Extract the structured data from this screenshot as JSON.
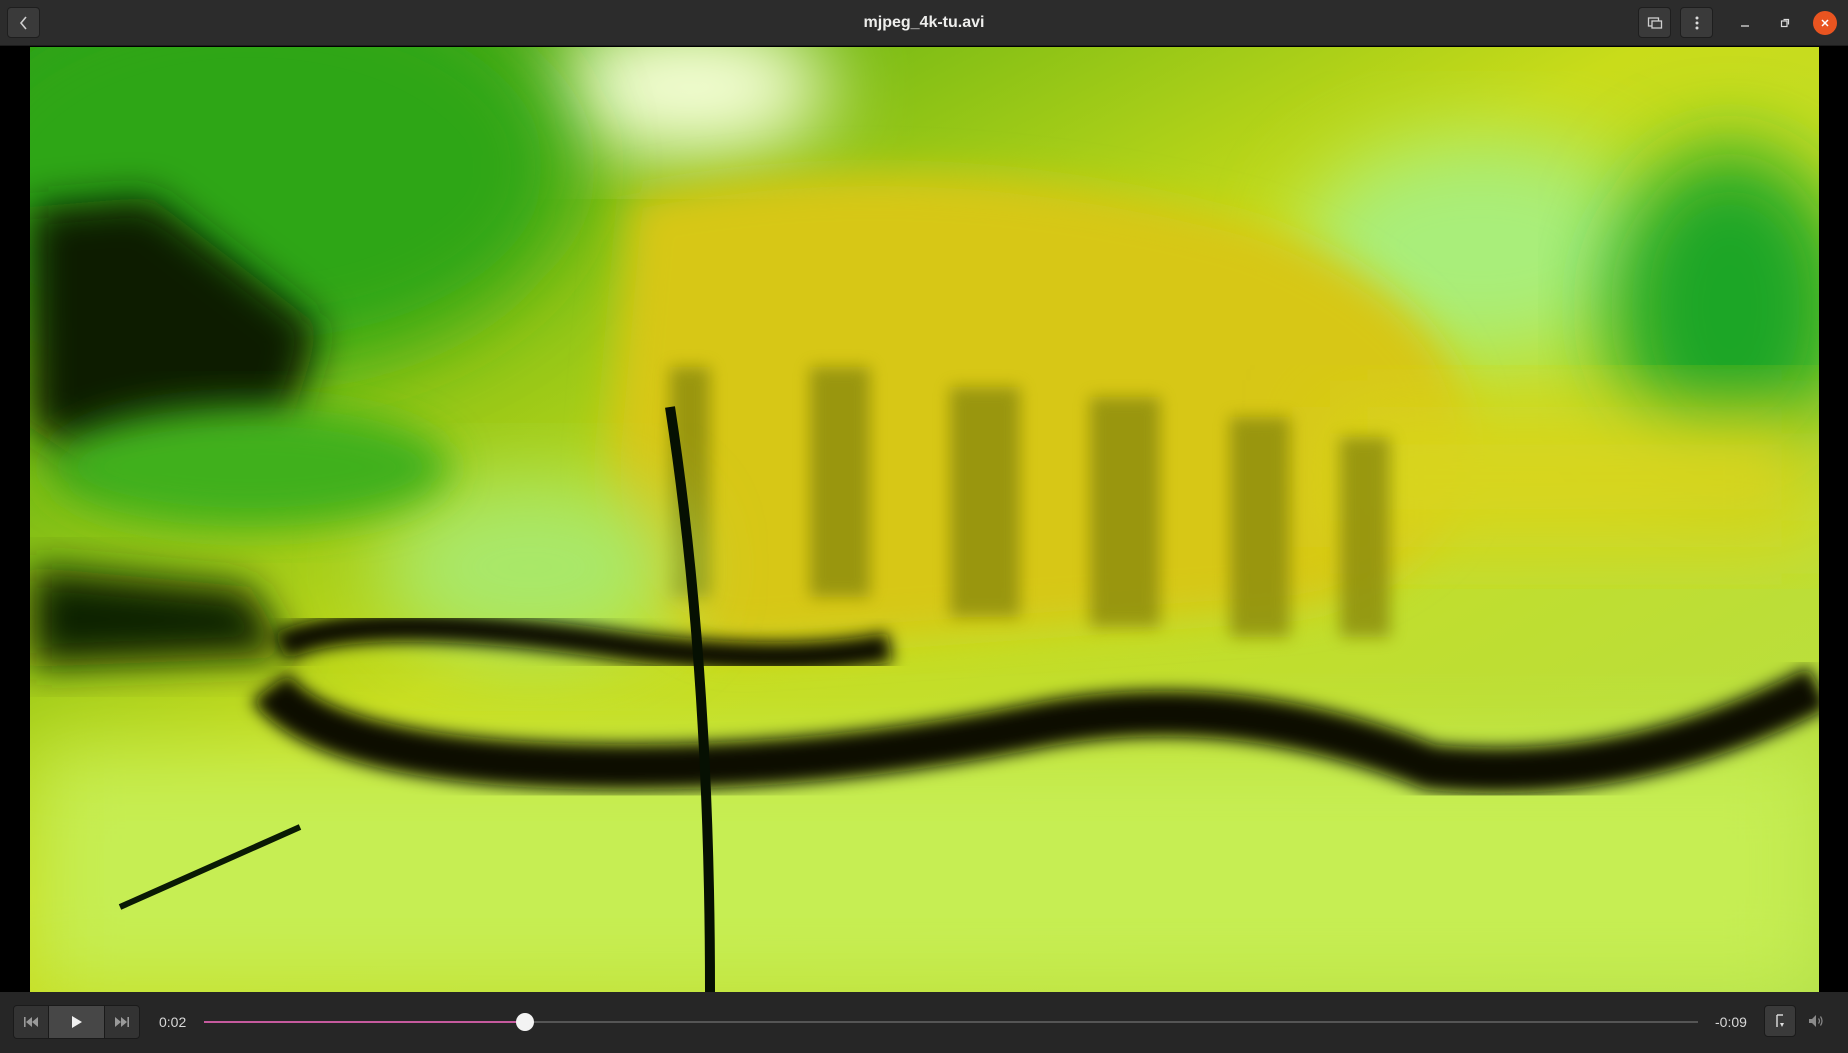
{
  "window": {
    "title": "mjpeg_4k-tu.avi"
  },
  "header": {
    "icons": {
      "back": "chevron-left-icon",
      "screen": "screen-icon",
      "menu": "vertical-dots-icon",
      "minimize": "minimize-icon",
      "maximize": "maximize-icon",
      "close": "close-icon"
    }
  },
  "player": {
    "elapsed": "0:02",
    "remaining": "-0:09",
    "progress": 0.215
  },
  "controls": {
    "icons": {
      "previous": "skip-back-icon",
      "play": "play-icon",
      "next": "skip-forward-icon",
      "subtitles": "subtitles-icon",
      "volume": "volume-icon"
    }
  },
  "colors": {
    "accent": "#c65a9e",
    "close": "#e95420",
    "headerbar": "#2c2c2c"
  }
}
